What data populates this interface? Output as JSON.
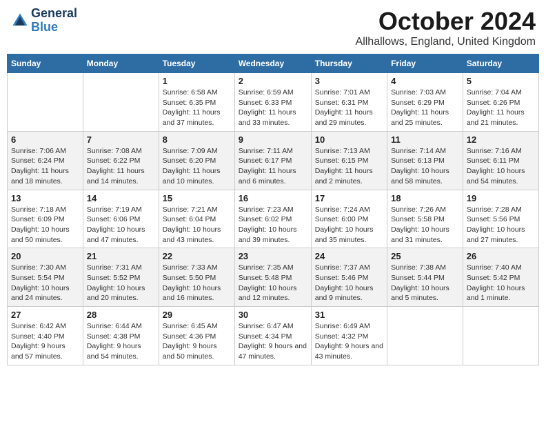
{
  "logo": {
    "line1": "General",
    "line2": "Blue"
  },
  "title": "October 2024",
  "location": "Allhallows, England, United Kingdom",
  "days_of_week": [
    "Sunday",
    "Monday",
    "Tuesday",
    "Wednesday",
    "Thursday",
    "Friday",
    "Saturday"
  ],
  "weeks": [
    [
      {
        "day": "",
        "info": ""
      },
      {
        "day": "",
        "info": ""
      },
      {
        "day": "1",
        "info": "Sunrise: 6:58 AM\nSunset: 6:35 PM\nDaylight: 11 hours and 37 minutes."
      },
      {
        "day": "2",
        "info": "Sunrise: 6:59 AM\nSunset: 6:33 PM\nDaylight: 11 hours and 33 minutes."
      },
      {
        "day": "3",
        "info": "Sunrise: 7:01 AM\nSunset: 6:31 PM\nDaylight: 11 hours and 29 minutes."
      },
      {
        "day": "4",
        "info": "Sunrise: 7:03 AM\nSunset: 6:29 PM\nDaylight: 11 hours and 25 minutes."
      },
      {
        "day": "5",
        "info": "Sunrise: 7:04 AM\nSunset: 6:26 PM\nDaylight: 11 hours and 21 minutes."
      }
    ],
    [
      {
        "day": "6",
        "info": "Sunrise: 7:06 AM\nSunset: 6:24 PM\nDaylight: 11 hours and 18 minutes."
      },
      {
        "day": "7",
        "info": "Sunrise: 7:08 AM\nSunset: 6:22 PM\nDaylight: 11 hours and 14 minutes."
      },
      {
        "day": "8",
        "info": "Sunrise: 7:09 AM\nSunset: 6:20 PM\nDaylight: 11 hours and 10 minutes."
      },
      {
        "day": "9",
        "info": "Sunrise: 7:11 AM\nSunset: 6:17 PM\nDaylight: 11 hours and 6 minutes."
      },
      {
        "day": "10",
        "info": "Sunrise: 7:13 AM\nSunset: 6:15 PM\nDaylight: 11 hours and 2 minutes."
      },
      {
        "day": "11",
        "info": "Sunrise: 7:14 AM\nSunset: 6:13 PM\nDaylight: 10 hours and 58 minutes."
      },
      {
        "day": "12",
        "info": "Sunrise: 7:16 AM\nSunset: 6:11 PM\nDaylight: 10 hours and 54 minutes."
      }
    ],
    [
      {
        "day": "13",
        "info": "Sunrise: 7:18 AM\nSunset: 6:09 PM\nDaylight: 10 hours and 50 minutes."
      },
      {
        "day": "14",
        "info": "Sunrise: 7:19 AM\nSunset: 6:06 PM\nDaylight: 10 hours and 47 minutes."
      },
      {
        "day": "15",
        "info": "Sunrise: 7:21 AM\nSunset: 6:04 PM\nDaylight: 10 hours and 43 minutes."
      },
      {
        "day": "16",
        "info": "Sunrise: 7:23 AM\nSunset: 6:02 PM\nDaylight: 10 hours and 39 minutes."
      },
      {
        "day": "17",
        "info": "Sunrise: 7:24 AM\nSunset: 6:00 PM\nDaylight: 10 hours and 35 minutes."
      },
      {
        "day": "18",
        "info": "Sunrise: 7:26 AM\nSunset: 5:58 PM\nDaylight: 10 hours and 31 minutes."
      },
      {
        "day": "19",
        "info": "Sunrise: 7:28 AM\nSunset: 5:56 PM\nDaylight: 10 hours and 27 minutes."
      }
    ],
    [
      {
        "day": "20",
        "info": "Sunrise: 7:30 AM\nSunset: 5:54 PM\nDaylight: 10 hours and 24 minutes."
      },
      {
        "day": "21",
        "info": "Sunrise: 7:31 AM\nSunset: 5:52 PM\nDaylight: 10 hours and 20 minutes."
      },
      {
        "day": "22",
        "info": "Sunrise: 7:33 AM\nSunset: 5:50 PM\nDaylight: 10 hours and 16 minutes."
      },
      {
        "day": "23",
        "info": "Sunrise: 7:35 AM\nSunset: 5:48 PM\nDaylight: 10 hours and 12 minutes."
      },
      {
        "day": "24",
        "info": "Sunrise: 7:37 AM\nSunset: 5:46 PM\nDaylight: 10 hours and 9 minutes."
      },
      {
        "day": "25",
        "info": "Sunrise: 7:38 AM\nSunset: 5:44 PM\nDaylight: 10 hours and 5 minutes."
      },
      {
        "day": "26",
        "info": "Sunrise: 7:40 AM\nSunset: 5:42 PM\nDaylight: 10 hours and 1 minute."
      }
    ],
    [
      {
        "day": "27",
        "info": "Sunrise: 6:42 AM\nSunset: 4:40 PM\nDaylight: 9 hours and 57 minutes."
      },
      {
        "day": "28",
        "info": "Sunrise: 6:44 AM\nSunset: 4:38 PM\nDaylight: 9 hours and 54 minutes."
      },
      {
        "day": "29",
        "info": "Sunrise: 6:45 AM\nSunset: 4:36 PM\nDaylight: 9 hours and 50 minutes."
      },
      {
        "day": "30",
        "info": "Sunrise: 6:47 AM\nSunset: 4:34 PM\nDaylight: 9 hours and 47 minutes."
      },
      {
        "day": "31",
        "info": "Sunrise: 6:49 AM\nSunset: 4:32 PM\nDaylight: 9 hours and 43 minutes."
      },
      {
        "day": "",
        "info": ""
      },
      {
        "day": "",
        "info": ""
      }
    ]
  ]
}
